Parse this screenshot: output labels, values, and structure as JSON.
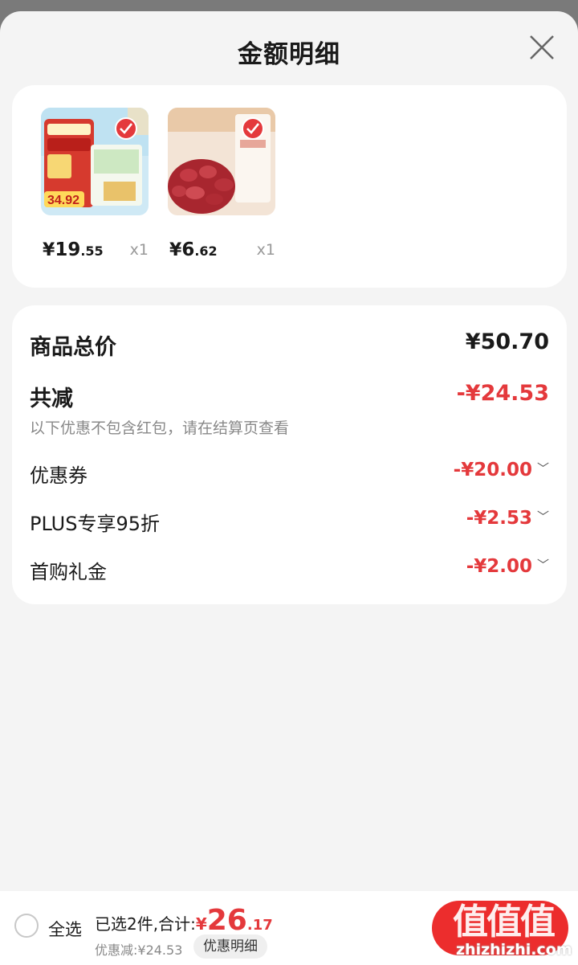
{
  "sheet": {
    "title": "金额明细"
  },
  "products": [
    {
      "price_symbol": "¥",
      "price_int": "19",
      "price_dec": ".55",
      "qty": "x1",
      "image": "five-grain-drink-product",
      "badge_text": "34.92"
    },
    {
      "price_symbol": "¥",
      "price_int": "6",
      "price_dec": ".62",
      "qty": "x1",
      "image": "red-peanuts-product",
      "badge_text": ""
    }
  ],
  "summary": {
    "goods_total_label": "商品总价",
    "goods_total_value": "¥50.70",
    "reduction_label": "共减",
    "reduction_value": "-¥24.53",
    "reduction_note": "以下优惠不包含红包，请在结算页查看",
    "items": [
      {
        "label": "优惠券",
        "value": "-¥20.00"
      },
      {
        "label": "PLUS专享95折",
        "value": "-¥2.53"
      },
      {
        "label": "首购礼金",
        "value": "-¥2.00"
      }
    ]
  },
  "bottom": {
    "select_all": "全选",
    "selected_text": "已选2件,合计:",
    "total_symbol": "¥",
    "total_int": "26",
    "total_dec": ".17",
    "savings_text": "优惠减:¥24.53",
    "detail_button": "优惠明细",
    "watermark_glyphs": "值值值",
    "watermark_url": "zhizhizhi.com"
  },
  "colors": {
    "accent": "#e4393c",
    "background": "#f4f4f4"
  }
}
